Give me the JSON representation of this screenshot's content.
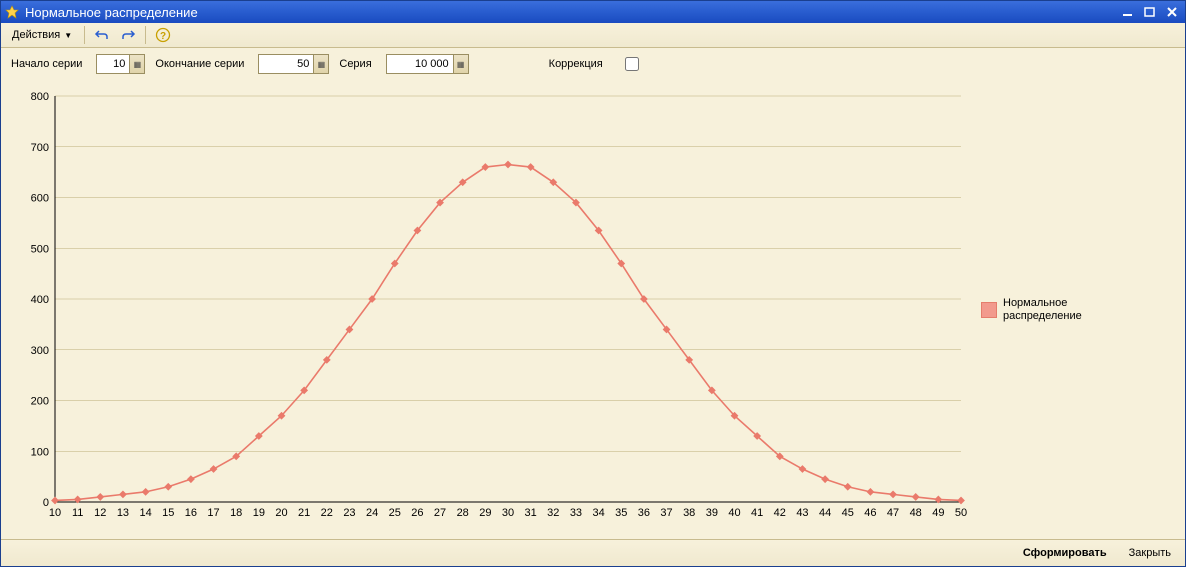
{
  "window": {
    "title": "Нормальное распределение"
  },
  "toolbar": {
    "actions_label": "Действия",
    "undo_icon": "undo-icon",
    "redo_icon": "redo-icon",
    "help_icon": "help-icon"
  },
  "params": {
    "start_label": "Начало серии",
    "start_value": "10",
    "end_label": "Окончание серии",
    "end_value": "50",
    "series_label": "Серия",
    "series_value": "10 000",
    "correction_label": "Коррекция",
    "correction_checked": false
  },
  "legend": {
    "label": "Нормальное\nраспределение"
  },
  "footer": {
    "form_label": "Сформировать",
    "close_label": "Закрыть"
  },
  "chart_data": {
    "type": "line",
    "title": "",
    "xlabel": "",
    "ylabel": "",
    "ylim": [
      0,
      800
    ],
    "yticks": [
      0,
      100,
      200,
      300,
      400,
      500,
      600,
      700,
      800
    ],
    "categories": [
      10,
      11,
      12,
      13,
      14,
      15,
      16,
      17,
      18,
      19,
      20,
      21,
      22,
      23,
      24,
      25,
      26,
      27,
      28,
      29,
      30,
      31,
      32,
      33,
      34,
      35,
      36,
      37,
      38,
      39,
      40,
      41,
      42,
      43,
      44,
      45,
      46,
      47,
      48,
      49,
      50
    ],
    "series": [
      {
        "name": "Нормальное распределение",
        "color": "#ea7a6b",
        "values": [
          3,
          5,
          10,
          15,
          20,
          30,
          45,
          65,
          90,
          130,
          170,
          220,
          280,
          340,
          400,
          470,
          535,
          590,
          630,
          660,
          665,
          660,
          630,
          590,
          535,
          470,
          400,
          340,
          280,
          220,
          170,
          130,
          90,
          65,
          45,
          30,
          20,
          15,
          10,
          5,
          3
        ]
      }
    ]
  }
}
